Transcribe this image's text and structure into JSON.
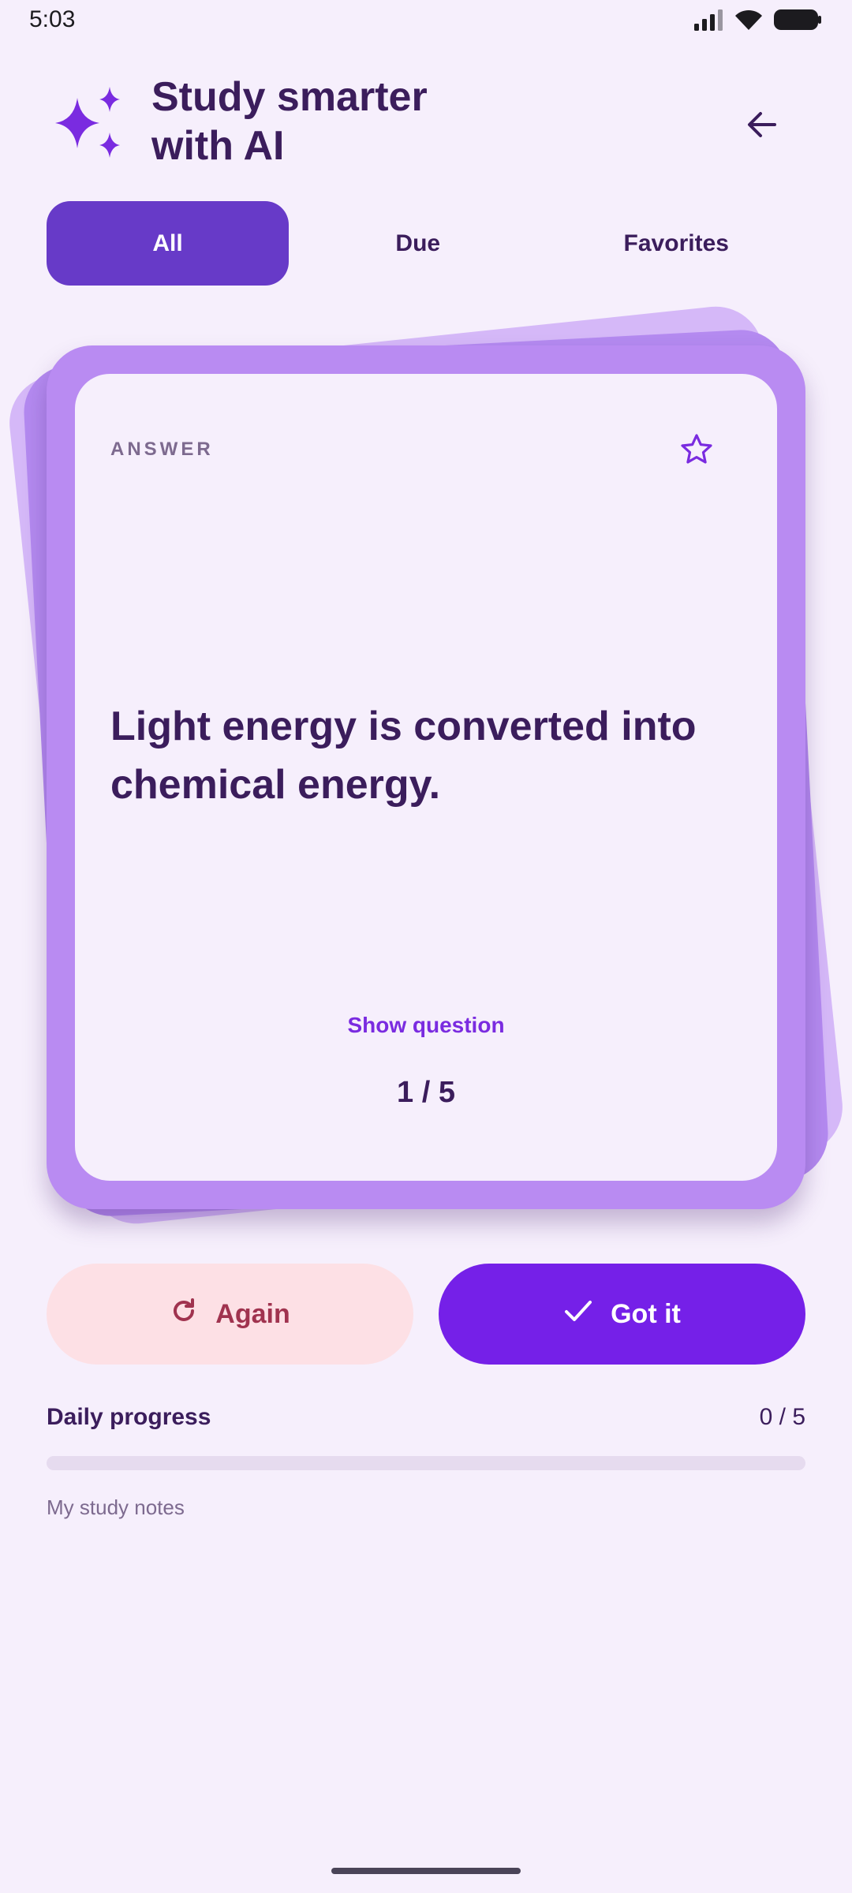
{
  "status_bar": {
    "time": "5:03",
    "icons": [
      "signal-icon",
      "wifi-icon",
      "battery-icon"
    ]
  },
  "header": {
    "title": "Study smarter\nwith AI",
    "logo_icon": "sparkle-icon",
    "back_icon": "arrow-left-icon"
  },
  "tabs": [
    {
      "label": "All",
      "active": true
    },
    {
      "label": "Due",
      "active": false
    },
    {
      "label": "Favorites",
      "active": false
    }
  ],
  "card": {
    "side_label": "ANSWER",
    "text": "Light energy is converted into chemical energy.",
    "favorite_icon": "star-outline-icon",
    "toggle_label": "Show question",
    "counter": "1 / 5"
  },
  "actions": {
    "again_label": "Again",
    "again_icon": "refresh-icon",
    "gotit_label": "Got it",
    "gotit_icon": "check-icon"
  },
  "progress": {
    "label": "Daily progress",
    "count": "0 / 5",
    "fraction": 0
  },
  "notes_link": "My study notes",
  "colors": {
    "background": "#f6effc",
    "primary": "#7520e8",
    "tab_active": "#673ac8",
    "card_frame": "#b98bf2",
    "again_bg": "#fde0e5",
    "again_text": "#a0334f",
    "text_dark": "#3b1d5c"
  }
}
